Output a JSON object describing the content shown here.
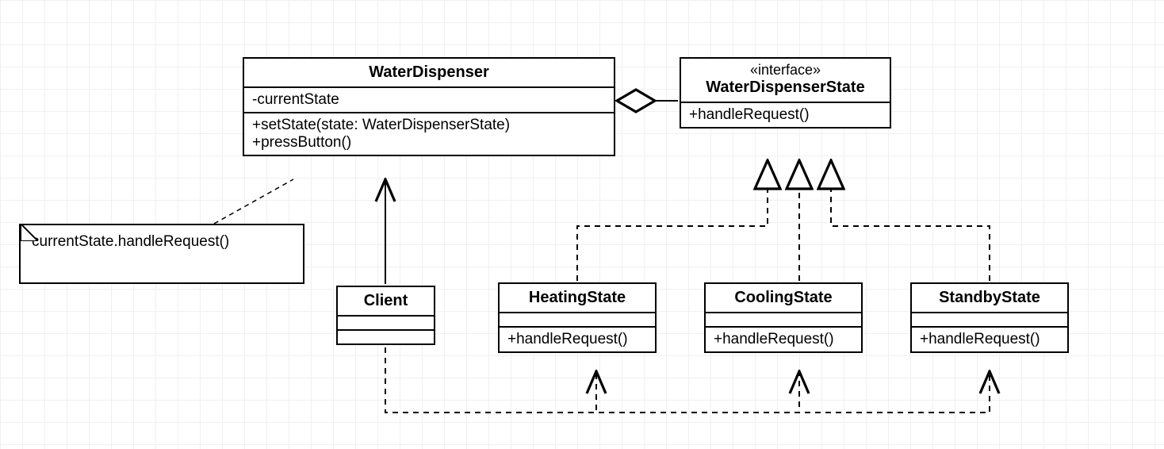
{
  "chart_data": {
    "type": "uml_class_diagram",
    "classes": [
      {
        "id": "WaterDispenser",
        "name": "WaterDispenser",
        "attributes": [
          "-currentState"
        ],
        "methods": [
          "+setState(state: WaterDispenserState)",
          "+pressButton()"
        ]
      },
      {
        "id": "WaterDispenserState",
        "stereotype": "«interface»",
        "name": "WaterDispenserState",
        "attributes": [],
        "methods": [
          "+handleRequest()"
        ]
      },
      {
        "id": "Client",
        "name": "Client",
        "attributes": [],
        "methods": []
      },
      {
        "id": "HeatingState",
        "name": "HeatingState",
        "attributes": [],
        "methods": [
          "+handleRequest()"
        ]
      },
      {
        "id": "CoolingState",
        "name": "CoolingState",
        "attributes": [],
        "methods": [
          "+handleRequest()"
        ]
      },
      {
        "id": "StandbyState",
        "name": "StandbyState",
        "attributes": [],
        "methods": [
          "+handleRequest()"
        ]
      }
    ],
    "note": {
      "text": "currentState.handleRequest()",
      "attached_to": "WaterDispenser"
    },
    "relationships": [
      {
        "from": "WaterDispenser",
        "to": "WaterDispenserState",
        "type": "aggregation"
      },
      {
        "from": "HeatingState",
        "to": "WaterDispenserState",
        "type": "realization"
      },
      {
        "from": "CoolingState",
        "to": "WaterDispenserState",
        "type": "realization"
      },
      {
        "from": "StandbyState",
        "to": "WaterDispenserState",
        "type": "realization"
      },
      {
        "from": "Client",
        "to": "WaterDispenser",
        "type": "association_arrow"
      },
      {
        "from": "Client",
        "to": "HeatingState",
        "type": "dependency"
      },
      {
        "from": "Client",
        "to": "CoolingState",
        "type": "dependency"
      },
      {
        "from": "Client",
        "to": "StandbyState",
        "type": "dependency"
      }
    ]
  },
  "boxes": {
    "wd": {
      "title": "WaterDispenser",
      "attr0": "-currentState",
      "meth0": "+setState(state: WaterDispenserState)",
      "meth1": "+pressButton()"
    },
    "wds": {
      "stereo": "«interface»",
      "title": "WaterDispenserState",
      "meth0": "+handleRequest()"
    },
    "client": {
      "title": "Client"
    },
    "heat": {
      "title": "HeatingState",
      "meth0": "+handleRequest()"
    },
    "cool": {
      "title": "CoolingState",
      "meth0": "+handleRequest()"
    },
    "stand": {
      "title": "StandbyState",
      "meth0": "+handleRequest()"
    }
  },
  "note_text": "currentState.handleRequest()"
}
